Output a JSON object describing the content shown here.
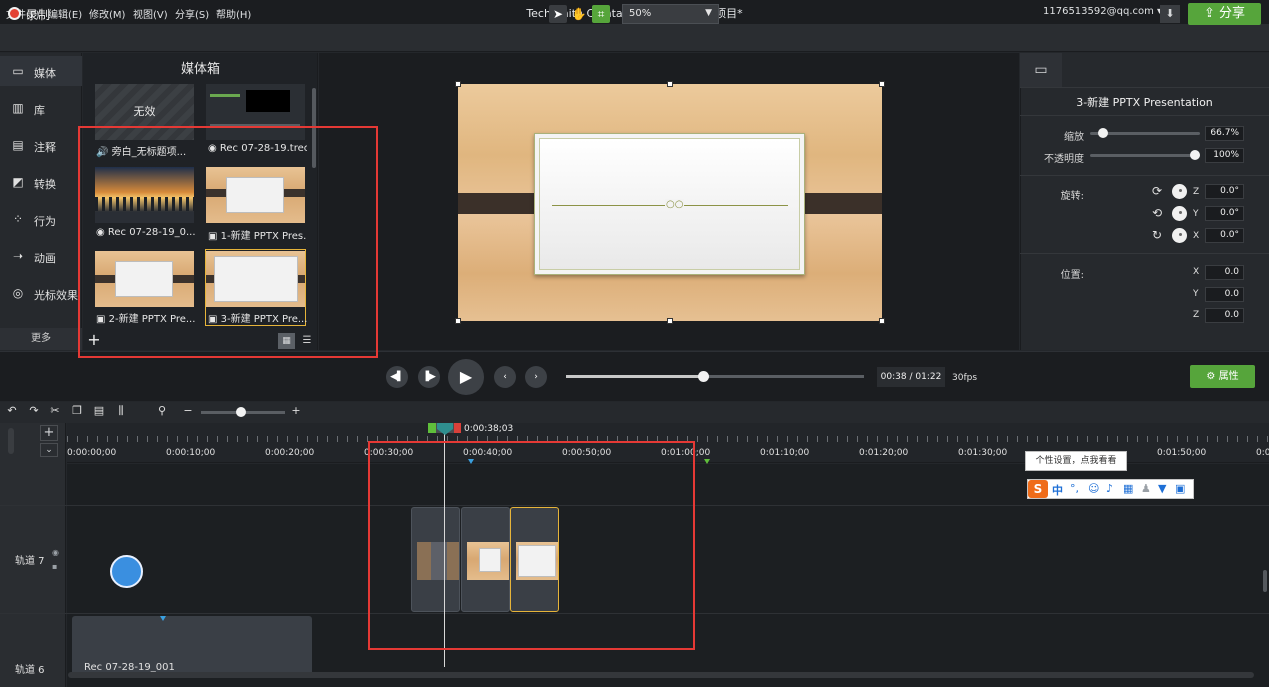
{
  "menu": {
    "items": [
      "文件(F)",
      "编辑(E)",
      "修改(M)",
      "视图(V)",
      "分享(S)",
      "帮助(H)"
    ],
    "title": "TechSmith Camtasia - 已恢复无标题项目*",
    "account": "1176513592@qq.com ▾"
  },
  "toolbar": {
    "record_label": "录制",
    "zoom": "50%",
    "share_label": "分享"
  },
  "sidebar": {
    "items": [
      {
        "label": "媒体",
        "icon": "film-icon"
      },
      {
        "label": "库",
        "icon": "library-icon"
      },
      {
        "label": "注释",
        "icon": "annotation-icon"
      },
      {
        "label": "转换",
        "icon": "transition-icon"
      },
      {
        "label": "行为",
        "icon": "behavior-icon"
      },
      {
        "label": "动画",
        "icon": "animation-icon"
      },
      {
        "label": "光标效果",
        "icon": "cursor-effect-icon"
      }
    ],
    "more_label": "更多"
  },
  "media_bin": {
    "title": "媒体箱",
    "none_label": "无效",
    "items": [
      {
        "caption": "🔊 旁白_无标题项..."
      },
      {
        "caption": "◉ Rec 07-28-19.trec"
      },
      {
        "caption": "◉ Rec 07-28-19_0..."
      },
      {
        "caption": "▣ 1-新建 PPTX Pres..."
      },
      {
        "caption": "▣ 2-新建 PPTX Pre..."
      },
      {
        "caption": "▣ 3-新建 PPTX Pre..."
      }
    ]
  },
  "properties": {
    "title": "3-新建 PPTX Presentation",
    "scale_label": "缩放",
    "scale_value": "66.7%",
    "scale_level": 0.08,
    "opacity_label": "不透明度",
    "opacity_value": "100%",
    "opacity_level": 1.0,
    "rotation_label": "旋转:",
    "rotation": [
      {
        "axis": "Z",
        "value": "0.0°"
      },
      {
        "axis": "Y",
        "value": "0.0°"
      },
      {
        "axis": "X",
        "value": "0.0°"
      }
    ],
    "position_label": "位置:",
    "position": [
      {
        "axis": "X",
        "value": "0.0"
      },
      {
        "axis": "Y",
        "value": "0.0"
      },
      {
        "axis": "Z",
        "value": "0.0"
      }
    ]
  },
  "playback": {
    "time": "00:38 / 01:22",
    "fps": "30fps",
    "progress": 0.46,
    "props_label": "属性"
  },
  "timeline": {
    "playhead_time": "0:00:38;03",
    "ticks": [
      "0:00:00;00",
      "0:00:10;00",
      "0:00:20;00",
      "0:00:30;00",
      "0:00:40;00",
      "0:00:50;00",
      "0:01:00;00",
      "0:01:10;00",
      "0:01:20;00",
      "0:01:30;00",
      "0:01:50;00",
      "0:0"
    ],
    "tracks": [
      {
        "label": "轨道 7"
      },
      {
        "label": "轨道 6"
      }
    ],
    "track6_clip_caption": "Rec 07-28-19_001"
  },
  "ime": {
    "tip": "个性设置，点我看看",
    "lang": "中"
  },
  "colors": {
    "accent_green": "#56a53b",
    "annotation_red": "#e53935",
    "selection_gold": "#e6b43a"
  }
}
